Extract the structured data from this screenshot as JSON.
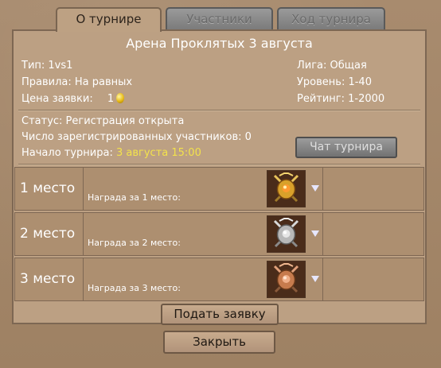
{
  "tabs": [
    {
      "label": "О турнире",
      "active": true
    },
    {
      "label": "Участники",
      "active": false
    },
    {
      "label": "Ход турнира",
      "active": false
    }
  ],
  "tournament": {
    "title": "Арена Проклятых 3 августа",
    "type": "Тип: 1vs1",
    "rules": "Правила: На равных",
    "fee_label": "Цена заявки:",
    "fee_value": "1",
    "league": "Лига: Общая",
    "level": "Уровень: 1-40",
    "rating": "Рейтинг: 1-2000"
  },
  "status": {
    "status_text": "Статус: Регистрация открыта",
    "registered": "Число зарегистрированных участников: 0",
    "start_label": "Начало турнира:",
    "start_value": "3 августа 15:00"
  },
  "chat_button": "Чат турнира",
  "prizes": [
    {
      "place": "1 место",
      "reward_label": "Награда за 1 место:",
      "chest": "gold-chest-icon"
    },
    {
      "place": "2 место",
      "reward_label": "Награда за 2 место:",
      "chest": "silver-chest-icon"
    },
    {
      "place": "3 место",
      "reward_label": "Награда за 3 место:",
      "chest": "bronze-chest-icon"
    }
  ],
  "buttons": {
    "submit": "Подать заявку",
    "close": "Закрыть"
  },
  "colors": {
    "background": "#a4876a",
    "panel": "#bca083",
    "highlight": "#f3e24b",
    "gold": "#e6b914",
    "silver": "#c8c8c8",
    "bronze": "#c77b4d"
  }
}
